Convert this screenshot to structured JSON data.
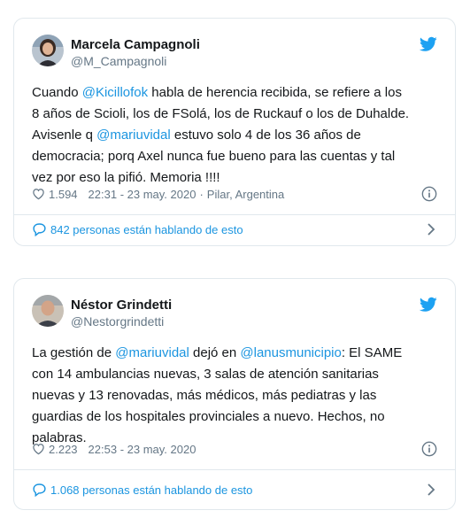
{
  "tweets": [
    {
      "display_name": "Marcela Campagnoli",
      "handle": "@M_Campagnoli",
      "avatar_icon": "avatar-woman",
      "lines": [
        [
          {
            "t": "Cuando ",
            "m": false
          },
          {
            "t": "@Kicillofok",
            "m": true
          },
          {
            "t": " habla de herencia recibida, se refiere a los",
            "m": false
          }
        ],
        [
          {
            "t": "8 años de Scioli, los de FSolá, los de Ruckauf o los de Duhalde.",
            "m": false
          }
        ],
        [
          {
            "t": "Avisenle q ",
            "m": false
          },
          {
            "t": "@mariuvidal",
            "m": true
          },
          {
            "t": " estuvo solo 4 de los 36 años de",
            "m": false
          }
        ],
        [
          {
            "t": "democracia; porq Axel nunca fue bueno para las cuentas y tal",
            "m": false
          }
        ],
        [
          {
            "t": "vez por eso la pifió. Memoria !!!!",
            "m": false
          }
        ]
      ],
      "likes": "1.594",
      "time": "22:31 - 23 may. 2020",
      "location": "Pilar, Argentina",
      "conversation": "842 personas están hablando de esto"
    },
    {
      "display_name": "Néstor Grindetti",
      "handle": "@Nestorgrindetti",
      "avatar_icon": "avatar-man",
      "lines": [
        [
          {
            "t": "La gestión de ",
            "m": false
          },
          {
            "t": "@mariuvidal",
            "m": true
          },
          {
            "t": " dejó en ",
            "m": false
          },
          {
            "t": "@lanusmunicipio",
            "m": true
          },
          {
            "t": ": El SAME",
            "m": false
          }
        ],
        [
          {
            "t": "con 14 ambulancias nuevas, 3 salas de atención sanitarias",
            "m": false
          }
        ],
        [
          {
            "t": "nuevas y 13 renovadas, más médicos, más pediatras y las",
            "m": false
          }
        ],
        [
          {
            "t": "guardias de los hospitales provinciales a nuevo. Hechos, no",
            "m": false
          }
        ],
        [
          {
            "t": "palabras.",
            "m": false
          }
        ]
      ],
      "likes": "2.223",
      "time": "22:53 - 23 may. 2020",
      "location": "",
      "conversation": "1.068 personas están hablando de esto"
    }
  ],
  "colors": {
    "link": "#1b95e0",
    "text": "#14171a",
    "muted": "#657786",
    "border": "#e1e8ed",
    "twitter_bird": "#1da1f2"
  },
  "icons": {
    "brand": "twitter-bird-icon",
    "like": "heart-outline-icon",
    "info": "info-circle-icon",
    "conversation": "speech-bubble-icon",
    "more": "chevron-right-icon"
  }
}
